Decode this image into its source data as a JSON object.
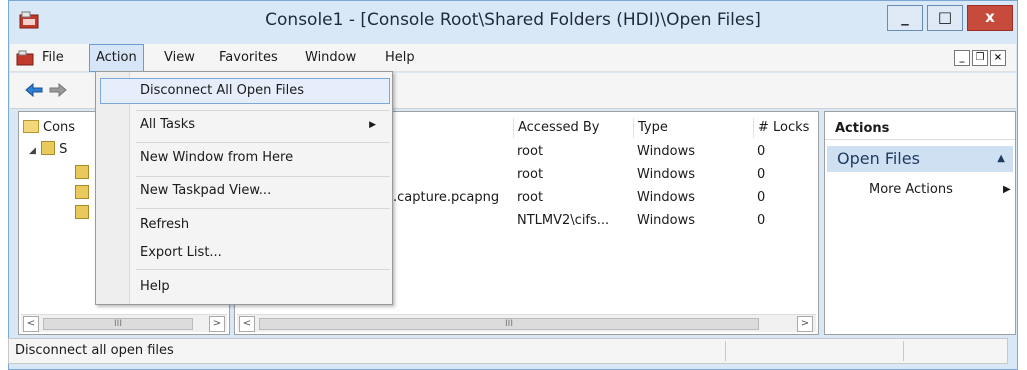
{
  "window": {
    "title": "Console1 - [Console Root\\Shared Folders (HDI)\\Open Files]",
    "controls": {
      "minimize": "_",
      "maximize": "□",
      "close": "x"
    }
  },
  "menubar": {
    "items": [
      "File",
      "Action",
      "View",
      "Favorites",
      "Window",
      "Help"
    ],
    "active": "Action",
    "mdi": {
      "minimize": "_",
      "restore": "❐",
      "close": "×"
    }
  },
  "tree": {
    "root_label": "Cons",
    "child_label": "S",
    "scroll_thumb": "III"
  },
  "list": {
    "columns": [
      "Accessed By",
      "Type",
      "# Locks"
    ],
    "rows": [
      {
        "file": "",
        "accessed_by": "root",
        "type": "Windows",
        "locks": "0"
      },
      {
        "file": "",
        "accessed_by": "root",
        "type": "Windows",
        "locks": "0"
      },
      {
        "file": ".capture.pcapng",
        "accessed_by": "root",
        "type": "Windows",
        "locks": "0"
      },
      {
        "file": "",
        "accessed_by": "NTLMV2\\cifs...",
        "type": "Windows",
        "locks": "0"
      }
    ],
    "scroll_thumb": "III"
  },
  "actions": {
    "title": "Actions",
    "group": "Open Files",
    "more": "More Actions"
  },
  "action_menu": {
    "items": [
      "Disconnect All Open Files",
      "All Tasks",
      "New Window from Here",
      "New Taskpad View...",
      "Refresh",
      "Export List...",
      "Help"
    ]
  },
  "status": {
    "text": "Disconnect all open files"
  },
  "colors": {
    "title_bg": "#d9e8f7",
    "close_button": "#c74b3c",
    "menu_highlight": "#e5eefa",
    "actions_group_bg": "#cfe0f2"
  }
}
